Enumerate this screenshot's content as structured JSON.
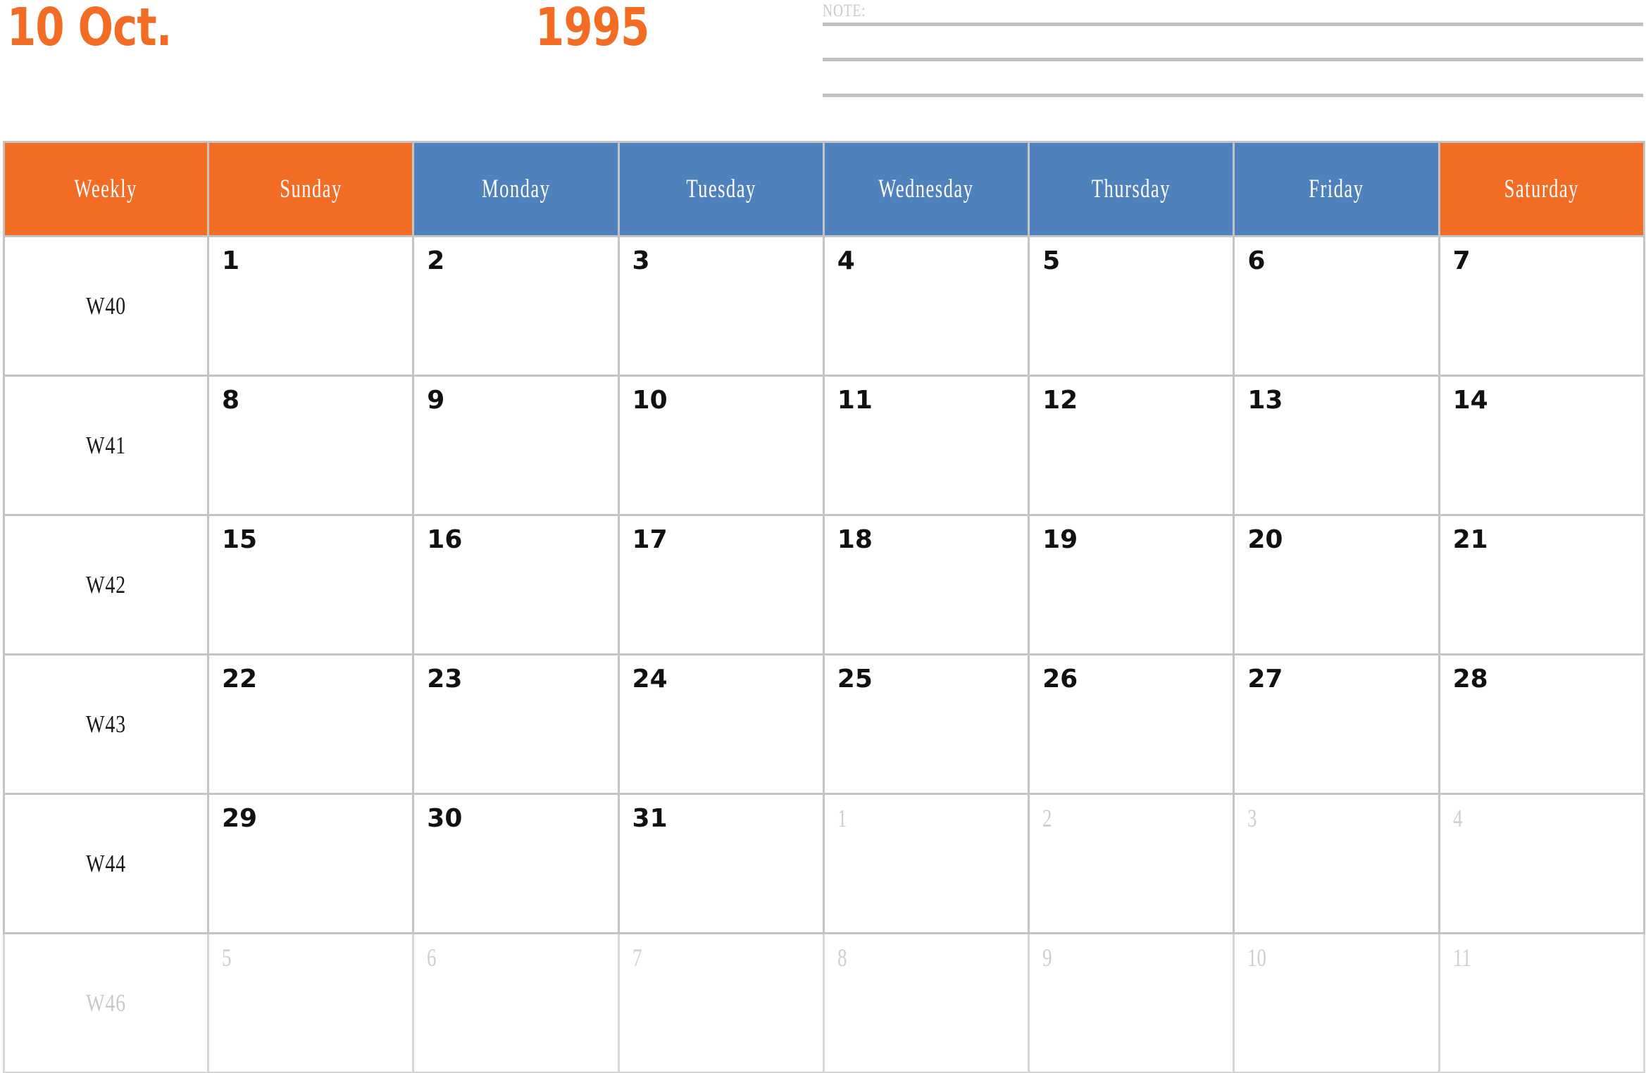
{
  "title": {
    "month": "10 Oct.",
    "year": "1995",
    "accent_color": "#F26C24"
  },
  "note": {
    "label": "NOTE:",
    "line_count": 3,
    "line_color": "#C0C0C0"
  },
  "colors": {
    "weekend_header": "#F26C24",
    "weekday_header": "#4F81BD",
    "grid_line": "#C4C4C4",
    "day_text": "#111111",
    "muted_text": "#CFCFCF"
  },
  "calendar": {
    "headers": [
      {
        "label": "Weekly",
        "style": "orange"
      },
      {
        "label": "Sunday",
        "style": "orange"
      },
      {
        "label": "Monday",
        "style": "blue"
      },
      {
        "label": "Tuesday",
        "style": "blue"
      },
      {
        "label": "Wednesday",
        "style": "blue"
      },
      {
        "label": "Thursday",
        "style": "blue"
      },
      {
        "label": "Friday",
        "style": "blue"
      },
      {
        "label": "Saturday",
        "style": "orange"
      }
    ],
    "rows": [
      {
        "week": "W40",
        "week_muted": false,
        "days": [
          {
            "num": "1",
            "out": false
          },
          {
            "num": "2",
            "out": false
          },
          {
            "num": "3",
            "out": false
          },
          {
            "num": "4",
            "out": false
          },
          {
            "num": "5",
            "out": false
          },
          {
            "num": "6",
            "out": false
          },
          {
            "num": "7",
            "out": false
          }
        ]
      },
      {
        "week": "W41",
        "week_muted": false,
        "days": [
          {
            "num": "8",
            "out": false
          },
          {
            "num": "9",
            "out": false
          },
          {
            "num": "10",
            "out": false
          },
          {
            "num": "11",
            "out": false
          },
          {
            "num": "12",
            "out": false
          },
          {
            "num": "13",
            "out": false
          },
          {
            "num": "14",
            "out": false
          }
        ]
      },
      {
        "week": "W42",
        "week_muted": false,
        "days": [
          {
            "num": "15",
            "out": false
          },
          {
            "num": "16",
            "out": false
          },
          {
            "num": "17",
            "out": false
          },
          {
            "num": "18",
            "out": false
          },
          {
            "num": "19",
            "out": false
          },
          {
            "num": "20",
            "out": false
          },
          {
            "num": "21",
            "out": false
          }
        ]
      },
      {
        "week": "W43",
        "week_muted": false,
        "days": [
          {
            "num": "22",
            "out": false
          },
          {
            "num": "23",
            "out": false
          },
          {
            "num": "24",
            "out": false
          },
          {
            "num": "25",
            "out": false
          },
          {
            "num": "26",
            "out": false
          },
          {
            "num": "27",
            "out": false
          },
          {
            "num": "28",
            "out": false
          }
        ]
      },
      {
        "week": "W44",
        "week_muted": false,
        "days": [
          {
            "num": "29",
            "out": false
          },
          {
            "num": "30",
            "out": false
          },
          {
            "num": "31",
            "out": false
          },
          {
            "num": "1",
            "out": true
          },
          {
            "num": "2",
            "out": true
          },
          {
            "num": "3",
            "out": true
          },
          {
            "num": "4",
            "out": true
          }
        ]
      },
      {
        "week": "W46",
        "week_muted": true,
        "days": [
          {
            "num": "5",
            "out": true
          },
          {
            "num": "6",
            "out": true
          },
          {
            "num": "7",
            "out": true
          },
          {
            "num": "8",
            "out": true
          },
          {
            "num": "9",
            "out": true
          },
          {
            "num": "10",
            "out": true
          },
          {
            "num": "11",
            "out": true
          }
        ]
      }
    ]
  }
}
